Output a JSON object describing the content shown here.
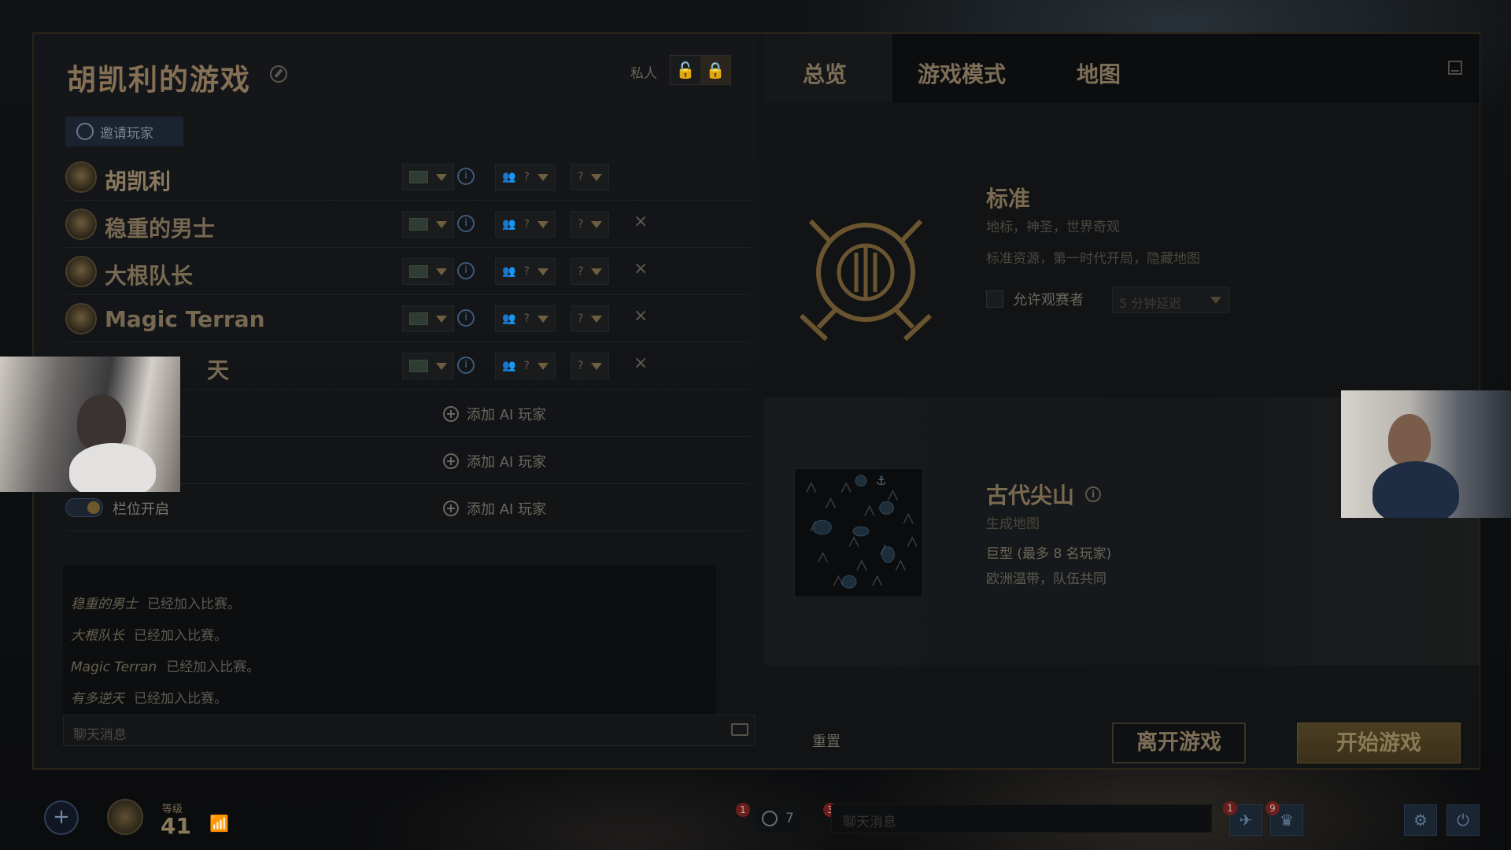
{
  "lobby": {
    "title": "胡凯利的游戏",
    "private_label": "私人",
    "invite_label": "邀请玩家",
    "players": [
      {
        "name": "胡凯利",
        "faction": "?"
      },
      {
        "name": "稳重的男士",
        "faction": "?"
      },
      {
        "name": "大根队长",
        "faction": "?"
      },
      {
        "name": "Magic Terran",
        "faction": "?"
      },
      {
        "name": "有多逆天",
        "name_visible": "天",
        "faction": "?"
      }
    ],
    "add_ai_label": "添加 AI 玩家",
    "slot_open_label": "栏位开启",
    "chat_log": [
      {
        "player": "稳重的男士",
        "msg": "已经加入比赛。"
      },
      {
        "player": "大根队长",
        "msg": "已经加入比赛。"
      },
      {
        "player": "Magic Terran",
        "msg": "已经加入比赛。"
      },
      {
        "player": "有多逆天",
        "msg": "已经加入比赛。"
      }
    ],
    "chat_placeholder": "聊天消息"
  },
  "tabs": [
    "总览",
    "游戏模式",
    "地图"
  ],
  "mode": {
    "name": "标准",
    "line1": "地标，神圣，世界奇观",
    "line2": "标准资源，第一时代开局，隐藏地图",
    "spectator_label": "允许观赛者",
    "delay_value": "5 分钟延迟"
  },
  "map": {
    "name": "古代尖山",
    "info_icon": "info-icon",
    "generated": "生成地图",
    "size": "巨型 (最多 8 名玩家)",
    "biome": "欧洲温带，队伍共同"
  },
  "actions": {
    "reset": "重置",
    "leave": "离开游戏",
    "start": "开始游戏"
  },
  "taskbar": {
    "level_label": "等级",
    "level": "41",
    "friends_count": "7",
    "badge_friends": "1",
    "badge_chat": "3",
    "badge_a": "1",
    "badge_b": "9",
    "chat_placeholder": "聊天消息"
  },
  "colors": {
    "accent_gold": "#8a7350",
    "info_blue": "#4a6f96"
  }
}
